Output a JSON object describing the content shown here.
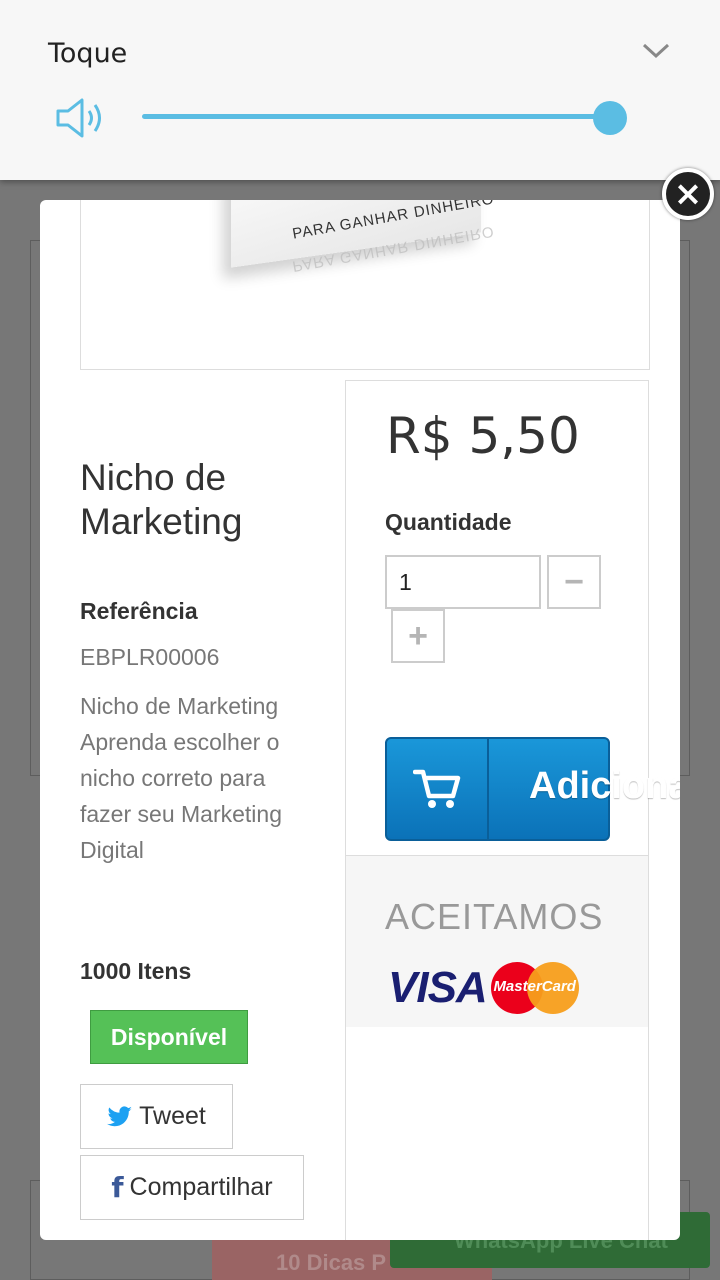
{
  "volume": {
    "title": "Toque",
    "level": 1.0
  },
  "background": {
    "promo_text": "10 Dicas P",
    "whatsapp_text": "WhatsApp Live Chat"
  },
  "product": {
    "image_text": "PARA GANHAR DINHEIRO",
    "image_reflection": "PARA GANHAR DINHEIRO",
    "name": "Nicho de Marketing",
    "reference_label": "Referência",
    "reference_value": "EBPLR00006",
    "description": "Nicho de Marketing Aprenda escolher o nicho correto para fazer seu Marketing Digital",
    "stock": "1000 Itens",
    "availability": "Disponível"
  },
  "share": {
    "tweet_label": "Tweet",
    "share_label": "Compartilhar"
  },
  "purchase": {
    "price": "R$ 5,50",
    "quantity_label": "Quantidade",
    "quantity_value": "1",
    "minus_label": "−",
    "plus_label": "+",
    "add_label": "Adiciona",
    "accept_label": "ACEITAMOS",
    "visa_label": "VISA",
    "mastercard_label": "MasterCard"
  },
  "close_label": "×",
  "colors": {
    "accent": "#5bbde3",
    "add_button": "#1a97d9",
    "available": "#55c157"
  }
}
